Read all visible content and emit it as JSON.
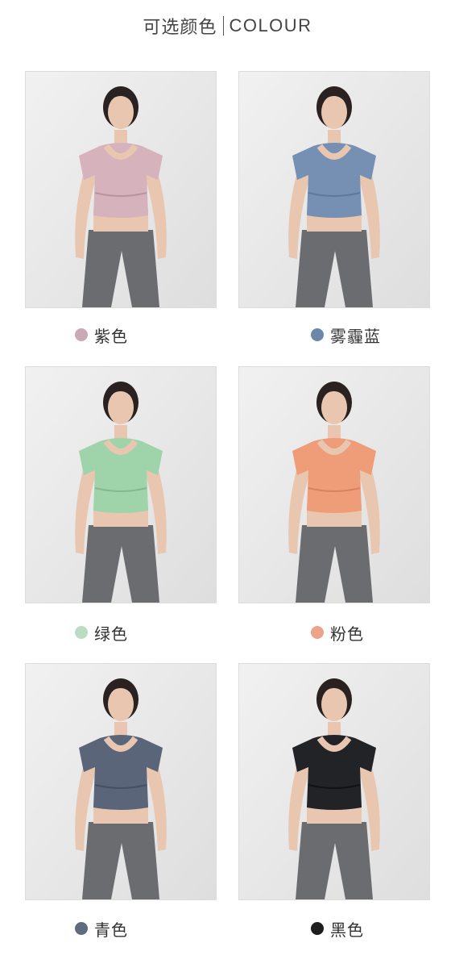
{
  "header": {
    "title_cn": "可选颜色",
    "title_en": "COLOUR"
  },
  "colors": [
    {
      "label": "紫色",
      "swatch": "#c9a9b6",
      "shirt": "#d5b2bc",
      "shirt_dark": "#b9949f"
    },
    {
      "label": "雾霾蓝",
      "swatch": "#6d87a8",
      "shirt": "#7590b3",
      "shirt_dark": "#5e7898"
    },
    {
      "label": "绿色",
      "swatch": "#b9dcc2",
      "shirt": "#9fd3a9",
      "shirt_dark": "#84b98e"
    },
    {
      "label": "粉色",
      "swatch": "#eba489",
      "shirt": "#ef9c78",
      "shirt_dark": "#d68360"
    },
    {
      "label": "青色",
      "swatch": "#5f6b7e",
      "shirt": "#5b6579",
      "shirt_dark": "#474f61"
    },
    {
      "label": "黑色",
      "swatch": "#1e1e1e",
      "shirt": "#222326",
      "shirt_dark": "#111214"
    }
  ],
  "style": {
    "legging": "#6b6c70",
    "skin": "#e8c6b0",
    "hair": "#2a2220"
  }
}
